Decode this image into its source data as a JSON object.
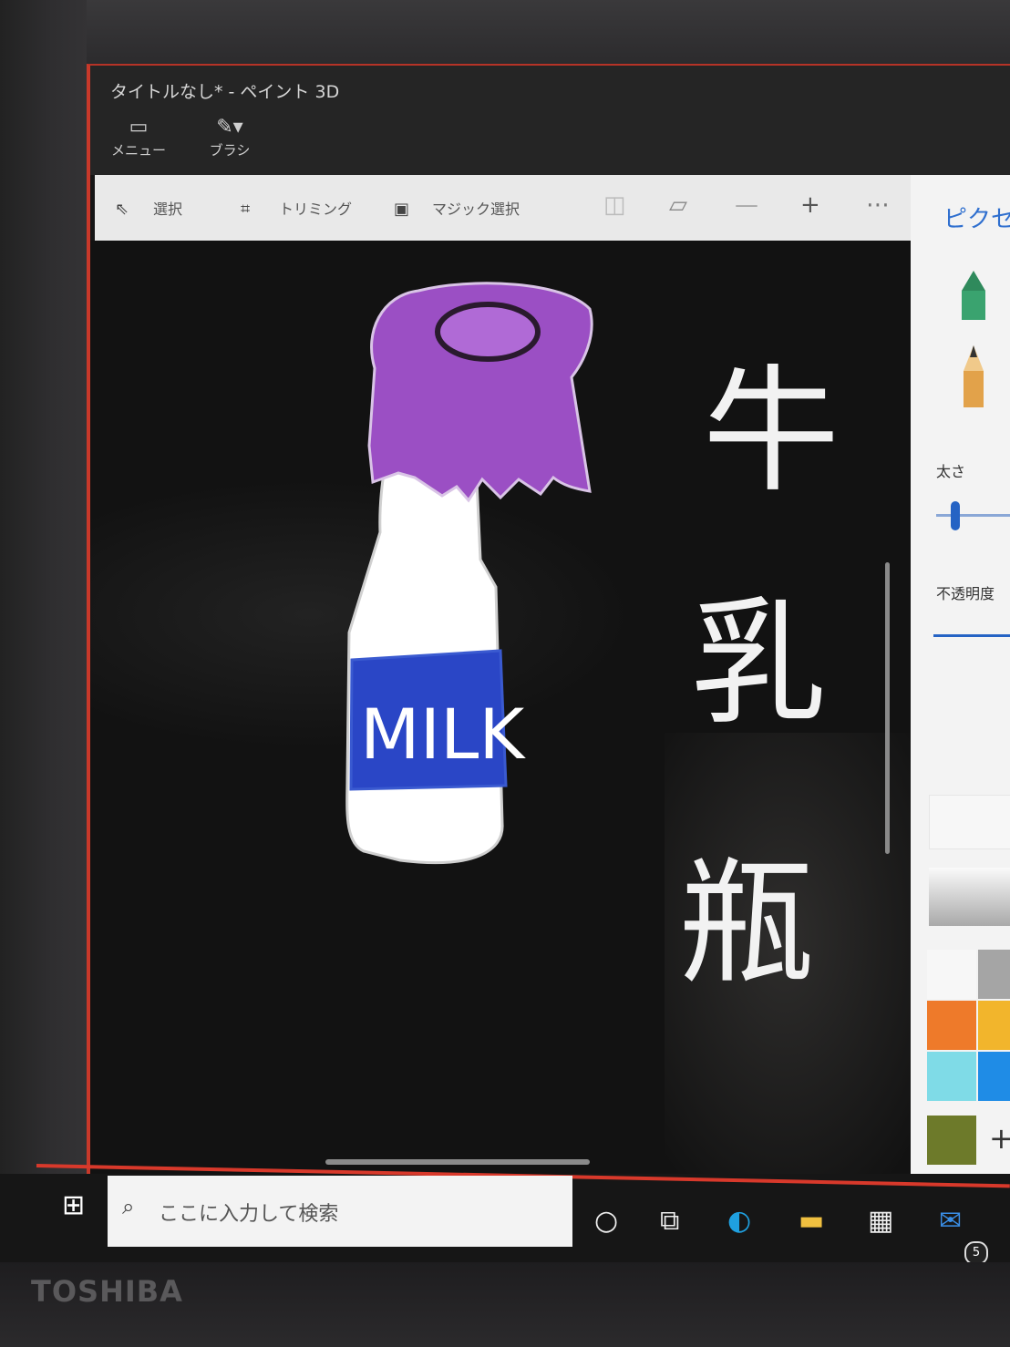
{
  "app": {
    "title": "タイトルなし* - ペイント 3D",
    "menu_label": "メニュー",
    "brush_label": "ブラシ"
  },
  "toolbar": {
    "select_label": "選択",
    "crop_label": "トリミング",
    "magic_select_label": "マジック選択"
  },
  "canvas": {
    "bottle_text": "MILK",
    "kanji": [
      "牛",
      "乳",
      "瓶"
    ]
  },
  "panel": {
    "title": "ピクセル",
    "thickness_label": "太さ",
    "opacity_label": "不透明度",
    "thickness_level": 0.25
  },
  "colors": {
    "accent": "#2563c4",
    "cap": "#9b4fc4",
    "label": "#2a46c6"
  },
  "taskbar": {
    "search_placeholder": "ここに入力して検索",
    "mail_badge": "5"
  },
  "bezel": {
    "brand": "TOSHIBA"
  }
}
